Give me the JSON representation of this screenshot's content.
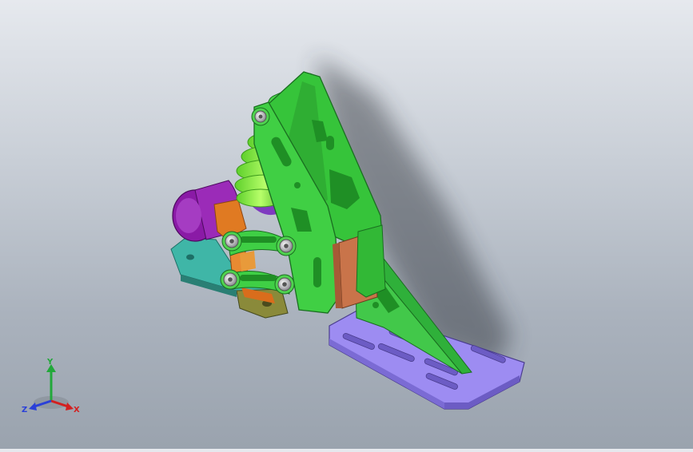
{
  "viewport": {
    "background_top": "#e6e9ee",
    "background_bottom": "#9aa3ae"
  },
  "model": {
    "colors": {
      "frame_green": "#36c43a",
      "frame_green_dark": "#1f8f25",
      "spring_green": "#8ef04a",
      "base_plate_purple": "#9d8cf2",
      "base_plate_dark": "#6c5cc4",
      "motor_purple": "#8a1aa6",
      "mount_orange": "#e07a22",
      "copper_spacer": "#c9744a",
      "base_teal": "#3fb6a7",
      "base_olive": "#8a8a3a",
      "bolt_silver": "#d8d8dc"
    }
  },
  "triad": {
    "x_label": "X",
    "y_label": "Y",
    "z_label": "Z",
    "x_color": "#d32020",
    "y_color": "#22a83a",
    "z_color": "#2a40d8"
  }
}
